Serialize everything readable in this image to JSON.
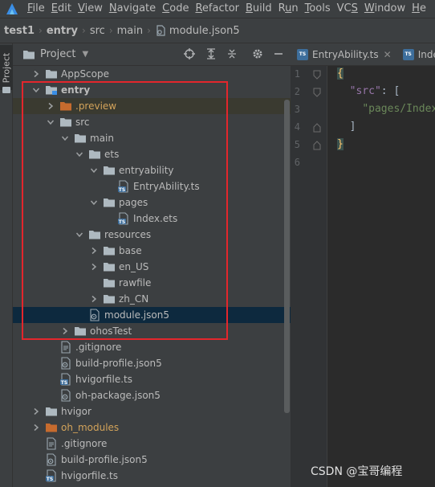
{
  "menubar": {
    "items": [
      "File",
      "Edit",
      "View",
      "Navigate",
      "Code",
      "Refactor",
      "Build",
      "Run",
      "Tools",
      "VCS",
      "Window",
      "He"
    ],
    "mnemonics": [
      "F",
      "E",
      "V",
      "N",
      "C",
      "R",
      "B",
      "u",
      "T",
      "S",
      "W",
      "H"
    ]
  },
  "breadcrumb": {
    "items": [
      "test1",
      "entry",
      "src",
      "main",
      "module.json5"
    ]
  },
  "toolstrip": {
    "label": "Project"
  },
  "project_panel": {
    "title": "Project",
    "tree": [
      {
        "label": "AppScope",
        "type": "folder",
        "expanded": false
      },
      {
        "label": "entry",
        "type": "module",
        "expanded": true
      },
      {
        "label": ".preview",
        "type": "folder-orange",
        "expanded": false
      },
      {
        "label": "src",
        "type": "folder",
        "expanded": true
      },
      {
        "label": "main",
        "type": "folder",
        "expanded": true
      },
      {
        "label": "ets",
        "type": "folder",
        "expanded": true
      },
      {
        "label": "entryability",
        "type": "folder",
        "expanded": true
      },
      {
        "label": "EntryAbility.ts",
        "type": "ts-file"
      },
      {
        "label": "pages",
        "type": "folder",
        "expanded": true
      },
      {
        "label": "Index.ets",
        "type": "ts-file"
      },
      {
        "label": "resources",
        "type": "folder",
        "expanded": true
      },
      {
        "label": "base",
        "type": "folder",
        "expanded": false
      },
      {
        "label": "en_US",
        "type": "folder",
        "expanded": false
      },
      {
        "label": "rawfile",
        "type": "folder"
      },
      {
        "label": "zh_CN",
        "type": "folder",
        "expanded": false
      },
      {
        "label": "module.json5",
        "type": "json-file",
        "selected": true
      },
      {
        "label": "ohosTest",
        "type": "folder",
        "expanded": false
      },
      {
        "label": ".gitignore",
        "type": "text-file"
      },
      {
        "label": "build-profile.json5",
        "type": "json-file"
      },
      {
        "label": "hvigorfile.ts",
        "type": "ts-file"
      },
      {
        "label": "oh-package.json5",
        "type": "json-file"
      },
      {
        "label": "hvigor",
        "type": "folder",
        "expanded": false
      },
      {
        "label": "oh_modules",
        "type": "folder-orange",
        "expanded": false
      },
      {
        "label": ".gitignore",
        "type": "text-file"
      },
      {
        "label": "build-profile.json5",
        "type": "json-file"
      },
      {
        "label": "hvigorfile.ts",
        "type": "ts-file"
      }
    ]
  },
  "editor": {
    "tabs": [
      "EntryAbility.ts",
      "Index"
    ],
    "line_numbers": [
      "1",
      "2",
      "3",
      "4",
      "5",
      "6"
    ],
    "code": {
      "l1": "{",
      "l2_key": "\"src\"",
      "l2_rest": ": [",
      "l3": "\"pages/Index\"",
      "l4": "]",
      "l5": "}"
    }
  },
  "watermark": "CSDN @宝哥编程",
  "colors": {
    "highlight_frame": "#e3262c",
    "selection_bg": "#0d293e",
    "folder": "#aeb9c0",
    "folder_orange": "#c66b2e",
    "ts_badge": "#3d6e9c"
  }
}
